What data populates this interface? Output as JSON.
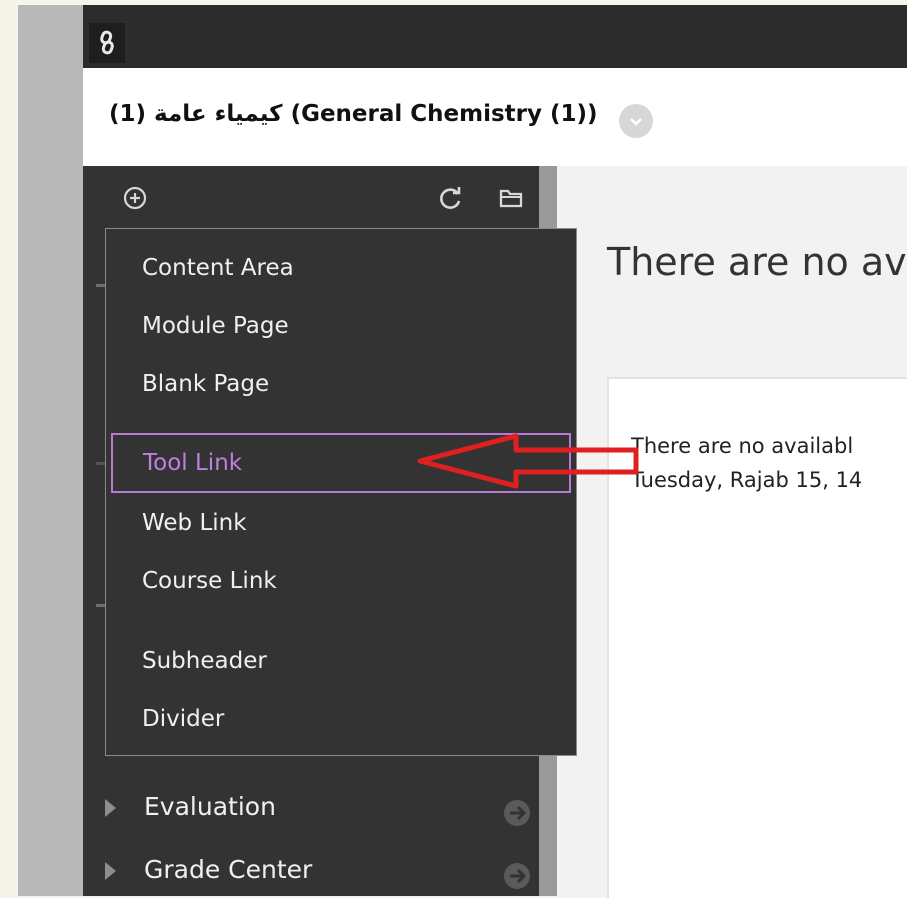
{
  "header": {
    "link_icon": "link-icon",
    "course_title": "(1) كيمياء عامة (General Chemistry (1))",
    "course_menu_icon": "chevron-down-icon"
  },
  "sidebar": {
    "toolbar": {
      "add_icon": "plus-circle-icon",
      "refresh_icon": "refresh-icon",
      "folder_icon": "folder-icon"
    },
    "add_menu_items": [
      {
        "label": "Content Area"
      },
      {
        "label": "Module Page"
      },
      {
        "label": "Blank Page"
      },
      {
        "label": "Tool Link",
        "highlighted": true
      },
      {
        "label": "Web Link"
      },
      {
        "label": "Course Link"
      },
      {
        "label": "Subheader"
      },
      {
        "label": "Divider"
      }
    ],
    "nav_items": [
      {
        "label": "Evaluation"
      },
      {
        "label": "Grade Center"
      }
    ]
  },
  "main": {
    "heading": "There are no av",
    "panel_line1": "There are no availabl",
    "panel_line2": "Tuesday, Rajab 15, 14"
  },
  "annotation": {
    "arrow_color": "#e02020",
    "highlight_color": "#b67ad6"
  }
}
